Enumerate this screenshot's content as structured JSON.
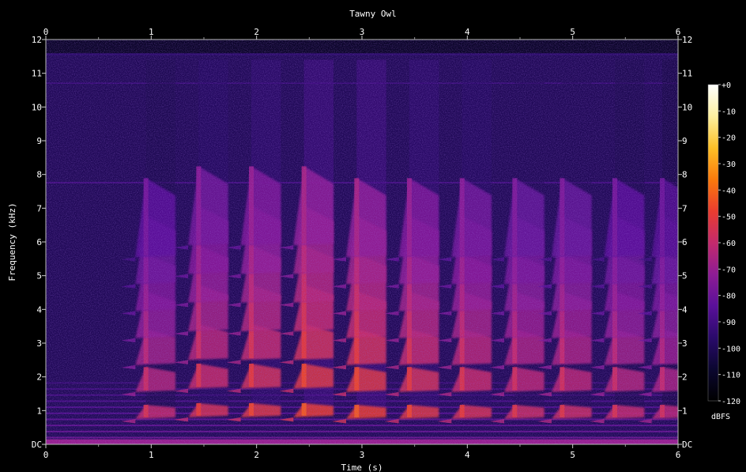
{
  "chart_data": {
    "type": "heatmap",
    "title": "Tawny Owl",
    "xlabel": "Time (s)",
    "ylabel": "Frequency (kHz)",
    "xlim": [
      0,
      6
    ],
    "ylim": [
      0,
      12
    ],
    "x_ticks": [
      "0",
      "1",
      "2",
      "3",
      "4",
      "5",
      "6"
    ],
    "y_ticks": [
      "DC",
      "1",
      "2",
      "3",
      "4",
      "5",
      "6",
      "7",
      "8",
      "9",
      "10",
      "11",
      "12"
    ],
    "colorbar": {
      "label": "dBFS",
      "range": [
        -120,
        0
      ],
      "ticks": [
        "+0",
        "-10",
        "-20",
        "-30",
        "-40",
        "-50",
        "-60",
        "-70",
        "-80",
        "-90",
        "-100",
        "-110",
        "-120"
      ],
      "colors": [
        "#000000",
        "#0b0730",
        "#2a0a6b",
        "#5a109a",
        "#8e1c95",
        "#c42a6c",
        "#ea3d2f",
        "#fb7a0c",
        "#fdc027",
        "#fdf0a0",
        "#ffffff"
      ]
    },
    "notes_start_s": [
      0.85,
      1.35,
      1.85,
      2.35,
      2.85,
      3.35,
      3.85,
      4.35,
      4.8,
      5.3,
      5.75
    ],
    "note_duration_s": 0.38,
    "fundamental_khz": [
      [
        0.9,
        0.8
      ],
      [
        0.95,
        0.85
      ],
      [
        0.95,
        0.85
      ],
      [
        0.95,
        0.85
      ],
      [
        0.9,
        0.8
      ],
      [
        0.9,
        0.8
      ],
      [
        0.9,
        0.8
      ],
      [
        0.9,
        0.8
      ],
      [
        0.9,
        0.8
      ],
      [
        0.9,
        0.8
      ],
      [
        0.9,
        0.8
      ]
    ],
    "harmonics": 7,
    "intensity_db": [
      -60,
      -55,
      -52,
      -48,
      -48,
      -52,
      -55,
      -58,
      -58,
      -60,
      -62
    ]
  }
}
